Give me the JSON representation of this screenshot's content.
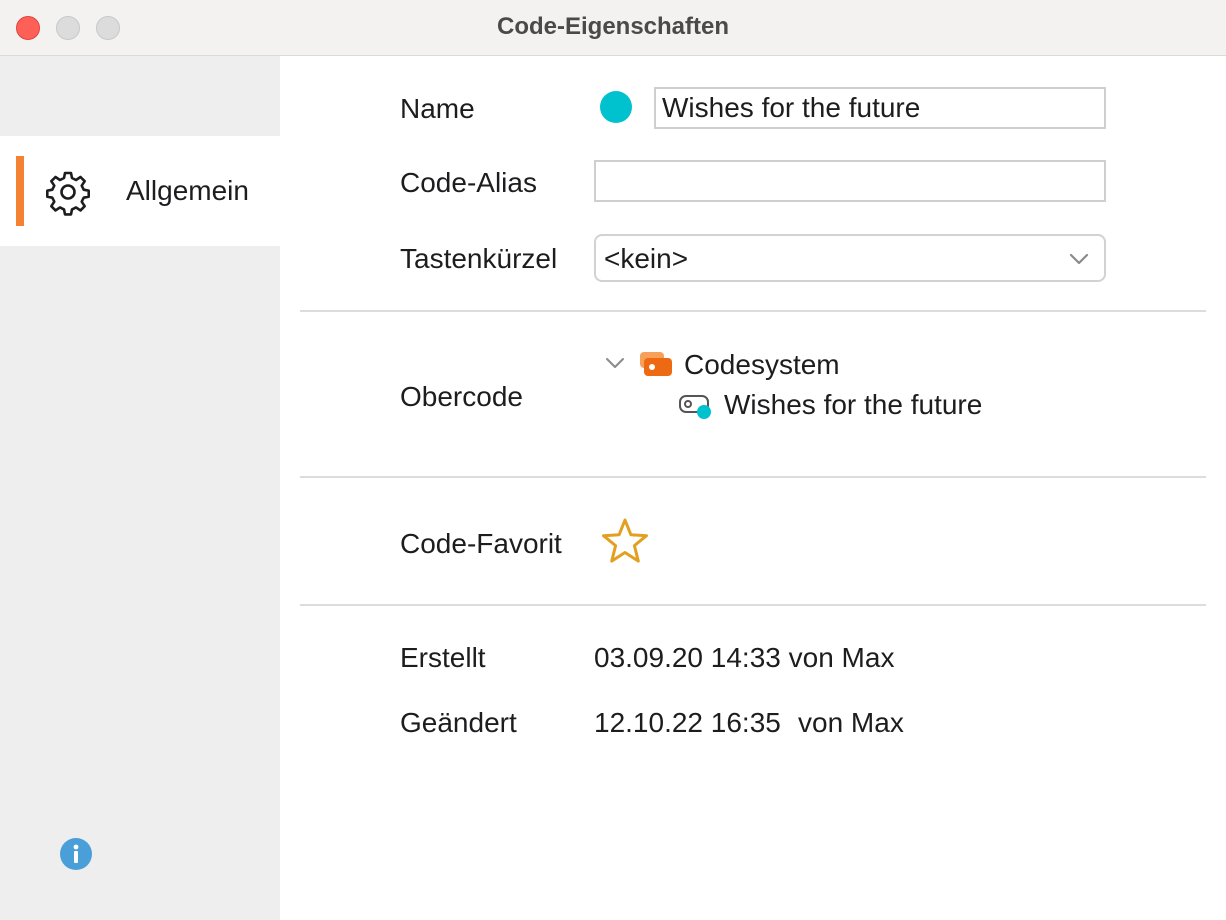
{
  "window": {
    "title": "Code-Eigenschaften"
  },
  "sidebar": {
    "items": [
      {
        "label": "Allgemein",
        "icon": "gear-icon",
        "selected": true
      }
    ],
    "accent_color": "#f58233",
    "info_icon": "info-icon"
  },
  "form": {
    "name_label": "Name",
    "name_value": "Wishes for the future",
    "code_color": "#00c2cf",
    "alias_label": "Code-Alias",
    "alias_value": "",
    "shortcut_label": "Tastenkürzel",
    "shortcut_value": "<kein>",
    "parent_label": "Obercode",
    "parent_tree": {
      "root": "Codesystem",
      "child": "Wishes for the future"
    },
    "favorite_label": "Code-Favorit",
    "favorite_active": false,
    "favorite_color": "#e3a020",
    "created_label": "Erstellt",
    "created_value": "03.09.20 14:33 von Max",
    "modified_label": "Geändert",
    "modified_date": "12.10.22 16:35",
    "modified_by": "von Max"
  }
}
